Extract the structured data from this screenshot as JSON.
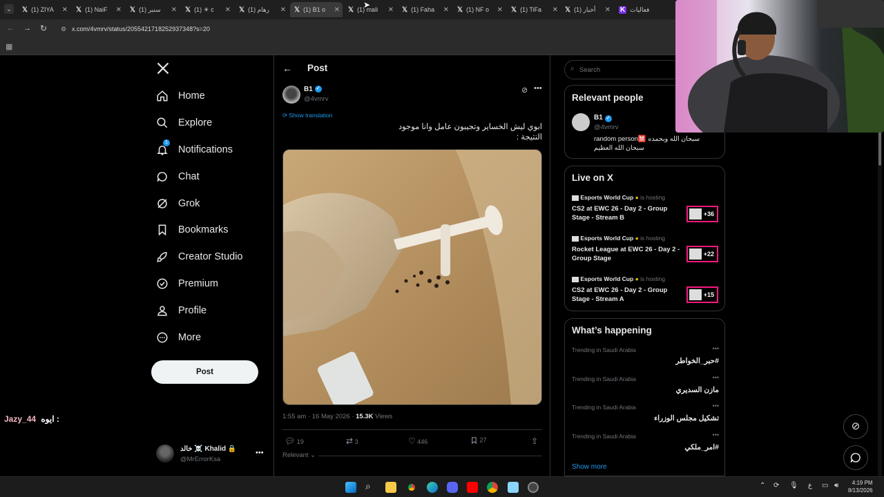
{
  "browser": {
    "tabs": [
      {
        "label": "(1) ZIYA",
        "active": false
      },
      {
        "label": "(1) NaiF",
        "active": false
      },
      {
        "label": "(1) سنبر",
        "active": false
      },
      {
        "label": "(1) ☀ c",
        "active": false
      },
      {
        "label": "(1) رهام",
        "active": false
      },
      {
        "label": "(1) B1 o",
        "active": true
      },
      {
        "label": "(1) mali",
        "active": false
      },
      {
        "label": "(1) Faha",
        "active": false
      },
      {
        "label": "(1) NF o",
        "active": false
      },
      {
        "label": "(1) TiFa",
        "active": false
      },
      {
        "label": "(1) أخبار",
        "active": false
      },
      {
        "label": "فعاليات",
        "active": false
      }
    ],
    "url": "x.com/4vmrv/status/2055421718252937348?s=20"
  },
  "nav": {
    "items": [
      {
        "label": "Home",
        "icon": "home-icon"
      },
      {
        "label": "Explore",
        "icon": "search-icon"
      },
      {
        "label": "Notifications",
        "icon": "bell-icon",
        "badge": "1"
      },
      {
        "label": "Chat",
        "icon": "chat-icon"
      },
      {
        "label": "Grok",
        "icon": "grok-icon"
      },
      {
        "label": "Bookmarks",
        "icon": "bookmark-icon"
      },
      {
        "label": "Creator Studio",
        "icon": "rocket-icon"
      },
      {
        "label": "Premium",
        "icon": "verified-icon"
      },
      {
        "label": "Profile",
        "icon": "person-icon"
      },
      {
        "label": "More",
        "icon": "more-circle-icon"
      }
    ],
    "post_label": "Post",
    "account": {
      "name": "خالد ☠️ Khalid 🔒",
      "handle": "@MrErrorKsa"
    }
  },
  "overlay": {
    "chat_user": "Jazy_44",
    "chat_text": "ايوه :"
  },
  "post": {
    "header_title": "Post",
    "author_name": "B1",
    "author_handle": "@4vmrv",
    "show_translation": "Show translation",
    "text_line1": "ابوي ليش الخساير وتجيبون عامل وانا موجود",
    "text_line2": "النتيجة :",
    "timestamp": "1:55 am · 16 May 2026 ·",
    "views_count": "15.3K",
    "views_label": "Views",
    "replies": "19",
    "reposts": "3",
    "likes": "446",
    "bookmarks": "27",
    "sort_label": "Relevant"
  },
  "sidebar": {
    "search_placeholder": "Search",
    "relevant": {
      "title": "Relevant people",
      "name": "B1",
      "handle": "@4vmrv",
      "bio_line1": "random person🈲 سبحان الله وبحمده",
      "bio_line2": "سبحان الله العظيم"
    },
    "live": {
      "title": "Live on X",
      "items": [
        {
          "host": "Esports World Cup",
          "is_hosting": "is hosting",
          "title": "CS2 at EWC 26 - Day 2 - Group Stage - Stream B",
          "count": "+36"
        },
        {
          "host": "Esports World Cup",
          "is_hosting": "is hosting",
          "title": "Rocket League at EWC 26 - Day 2 - Group Stage",
          "count": "+22"
        },
        {
          "host": "Esports World Cup",
          "is_hosting": "is hosting",
          "title": "CS2 at EWC 26 - Day 2 - Group Stage - Stream A",
          "count": "+15"
        }
      ]
    },
    "happening": {
      "title": "What’s happening",
      "items": [
        {
          "meta": "Trending in Saudi Arabia",
          "name": "#حبر_الخواطر"
        },
        {
          "meta": "Trending in Saudi Arabia",
          "name": "مازن السديري"
        },
        {
          "meta": "Trending in Saudi Arabia",
          "name": "تشكيل مجلس الوزراء"
        },
        {
          "meta": "Trending in Saudi Arabia",
          "name": "#امر_ملكي"
        }
      ],
      "show_more": "Show more"
    }
  },
  "taskbar": {
    "time": "4:19 PM",
    "date": "8/13/2026",
    "lang": "ع"
  },
  "colors": {
    "accent": "#1d9bf0",
    "bg": "#000000",
    "border": "#2f3336",
    "live": "#f91880"
  }
}
